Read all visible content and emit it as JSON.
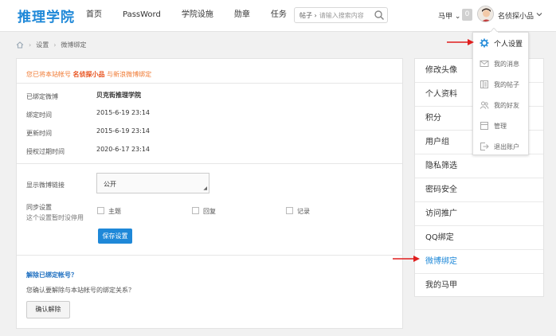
{
  "header": {
    "logo": "推理学院",
    "nav": [
      "首页",
      "PassWord",
      "学院设施",
      "勋章",
      "任务"
    ],
    "search_category": "帖子 ›",
    "search_placeholder": "请输入搜索内容",
    "user_alt_link": "马甲 ⌄",
    "notification_count": "0",
    "username": "名侦探小品"
  },
  "breadcrumb": {
    "items": [
      "设置",
      "微博绑定"
    ]
  },
  "main": {
    "notice_prefix": "您已将本站帐号",
    "notice_account": "名侦探小品",
    "notice_suffix": "与新浪微博绑定",
    "info": [
      {
        "label": "已绑定微博",
        "value": "贝克街推理学院"
      },
      {
        "label": "绑定时间",
        "value": "2015-6-19 23:14"
      },
      {
        "label": "更新时间",
        "value": "2015-6-19 23:14"
      },
      {
        "label": "授权过期时间",
        "value": "2020-6-17 23:14"
      }
    ],
    "display_label": "显示微博链接",
    "display_value": "公开",
    "sync_label": "同步设置",
    "sync_note": "这个设置暂时没停用",
    "sync_options": [
      "主题",
      "回复",
      "记录"
    ],
    "save_label": "保存设置",
    "unbind_title": "解除已绑定帐号？",
    "unbind_question": "您确认要解除与本站帐号的绑定关系？",
    "confirm_label": "确认解除"
  },
  "sidebar": {
    "items": [
      "修改头像",
      "个人资料",
      "积分",
      "用户组",
      "隐私筛选",
      "密码安全",
      "访问推广",
      "QQ绑定",
      "微博绑定",
      "我的马甲"
    ],
    "active_index": 8
  },
  "dropdown": {
    "items": [
      {
        "label": "个人设置",
        "icon": "gear-icon"
      },
      {
        "label": "我的消息",
        "icon": "mail-icon"
      },
      {
        "label": "我的帖子",
        "icon": "document-icon"
      },
      {
        "label": "我的好友",
        "icon": "friends-icon"
      },
      {
        "label": "管理",
        "icon": "window-icon"
      },
      {
        "label": "退出账户",
        "icon": "logout-icon"
      }
    ]
  },
  "colors": {
    "brand": "#1e88d8",
    "notice": "#f07a33",
    "annotation_arrow": "#e01e1e"
  }
}
